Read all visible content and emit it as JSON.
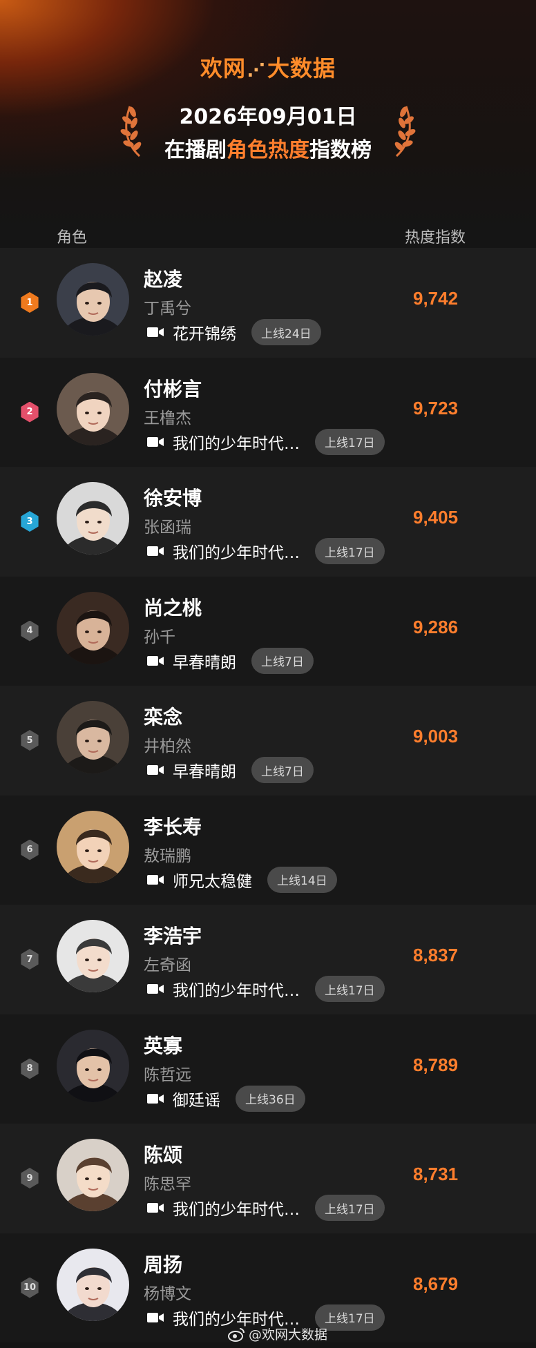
{
  "header": {
    "brand_left": "欢网",
    "brand_spark": "⋰",
    "brand_right": "大数据",
    "date": "2026年09月01日",
    "title_prefix": "在播剧",
    "title_highlight": "角色热度",
    "title_suffix": "指数榜"
  },
  "columns": {
    "role": "角色",
    "heat": "热度指数"
  },
  "colors": {
    "accent": "#ff7e2d",
    "rank1": "#ef7a1e",
    "rank2": "#e4506b",
    "rank3": "#27a6d6",
    "rank_other": "#5a5a5a"
  },
  "rows": [
    {
      "rank": "1",
      "name": "赵凌",
      "actor": "丁禹兮",
      "show": "花开锦绣",
      "online": "上线24日",
      "score": "9,742"
    },
    {
      "rank": "2",
      "name": "付彬言",
      "actor": "王橹杰",
      "show": "我们的少年时代…",
      "online": "上线17日",
      "score": "9,723"
    },
    {
      "rank": "3",
      "name": "徐安博",
      "actor": "张函瑞",
      "show": "我们的少年时代…",
      "online": "上线17日",
      "score": "9,405"
    },
    {
      "rank": "4",
      "name": "尚之桃",
      "actor": "孙千",
      "show": "早春晴朗",
      "online": "上线7日",
      "score": "9,286"
    },
    {
      "rank": "5",
      "name": "栾念",
      "actor": "井柏然",
      "show": "早春晴朗",
      "online": "上线7日",
      "score": "9,003"
    },
    {
      "rank": "6",
      "name": "李长寿",
      "actor": "敖瑞鹏",
      "show": "师兄太稳健",
      "online": "上线14日",
      "score": ""
    },
    {
      "rank": "7",
      "name": "李浩宇",
      "actor": "左奇函",
      "show": "我们的少年时代…",
      "online": "上线17日",
      "score": "8,837"
    },
    {
      "rank": "8",
      "name": "英寡",
      "actor": "陈哲远",
      "show": "御廷谣",
      "online": "上线36日",
      "score": "8,789"
    },
    {
      "rank": "9",
      "name": "陈颂",
      "actor": "陈思罕",
      "show": "我们的少年时代…",
      "online": "上线17日",
      "score": "8,731"
    },
    {
      "rank": "10",
      "name": "周扬",
      "actor": "杨博文",
      "show": "我们的少年时代…",
      "online": "上线17日",
      "score": "8,679"
    }
  ],
  "footer": {
    "watermark": "@欢网大数据"
  }
}
